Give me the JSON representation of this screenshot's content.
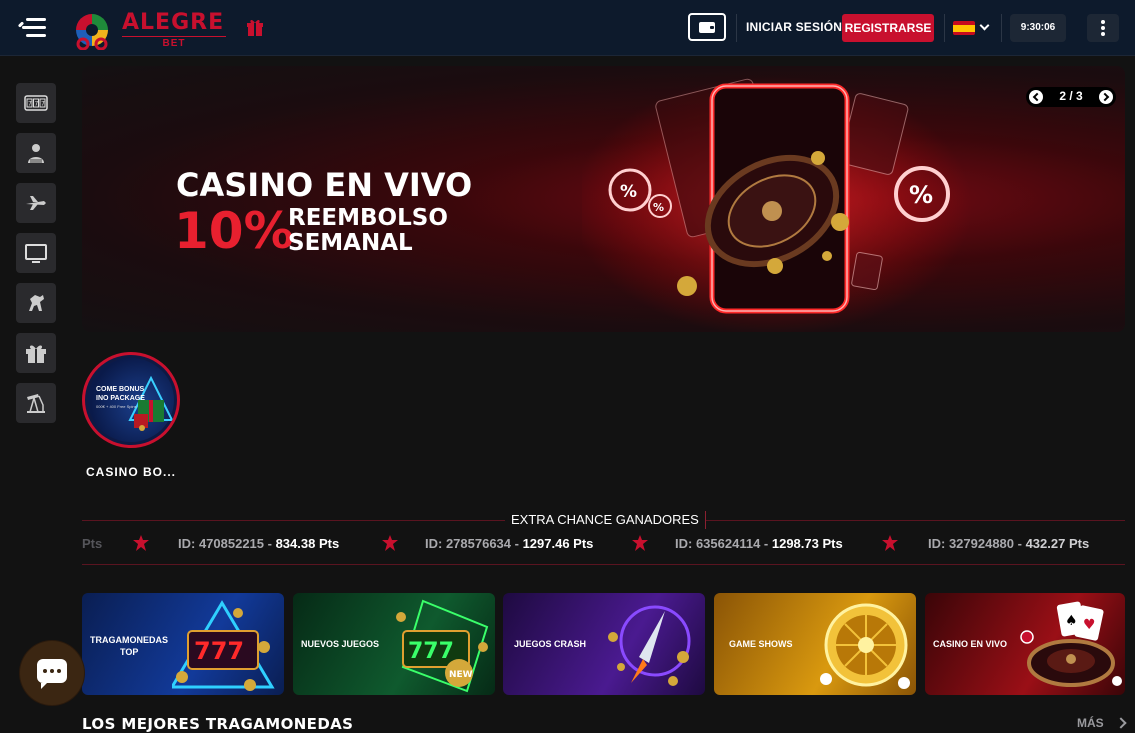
{
  "header": {
    "logo_text": "ALEGRE",
    "logo_sub": "BET",
    "login_label": "INICIAR SESIÓN",
    "register_label": "REGISTRARSE",
    "clock": "9:30:06",
    "language": "ES"
  },
  "sidebar": {
    "items": [
      {
        "icon": "slot-machine-icon"
      },
      {
        "icon": "croupier-icon"
      },
      {
        "icon": "airplane-icon"
      },
      {
        "icon": "tv-icon"
      },
      {
        "icon": "horse-racing-icon"
      },
      {
        "icon": "gift-icon"
      },
      {
        "icon": "oil-pump-icon"
      }
    ]
  },
  "banner": {
    "title": "CASINO EN VIVO",
    "percent": "10%",
    "subtitle_line1": "REEMBOLSO",
    "subtitle_line2": "SEMANAL",
    "slide_counter": "2 / 3"
  },
  "story": {
    "label": "CASINO BO...",
    "img_line1": "COME BONUS",
    "img_line2": "INO PACKAGE",
    "img_line3": "000€ + 400 Free Spins"
  },
  "ticker": {
    "title": "EXTRA CHANCE GANADORES",
    "lead_fragment": "Pts",
    "entries": [
      {
        "id": "ID: 470852215 -",
        "pts": "834.38 Pts"
      },
      {
        "id": "ID: 278576634 -",
        "pts": "1297.46 Pts"
      },
      {
        "id": "ID: 635624114 -",
        "pts": "1298.73 Pts"
      },
      {
        "id": "ID: 327924880 -",
        "pts": "432.27 Pts"
      }
    ]
  },
  "categories": [
    {
      "line1": "TRAGAMONEDAS",
      "line2": "TOP",
      "color": "#0d2a6e"
    },
    {
      "line1": "NUEVOS JUEGOS",
      "line2": "",
      "color": "#0b4a2a"
    },
    {
      "line1": "JUEGOS CRASH",
      "line2": "",
      "color": "#3a1468"
    },
    {
      "line1": "GAME SHOWS",
      "line2": "",
      "color": "#b8770a"
    },
    {
      "line1": "CASINO EN VIVO",
      "line2": "",
      "color": "#7a0c12"
    }
  ],
  "section": {
    "title": "LOS MEJORES TRAGAMONEDAS",
    "more_label": "MÁS"
  },
  "colors": {
    "accent": "#c8102e",
    "header_bg": "#0d1a2c",
    "page_bg": "#121212"
  }
}
